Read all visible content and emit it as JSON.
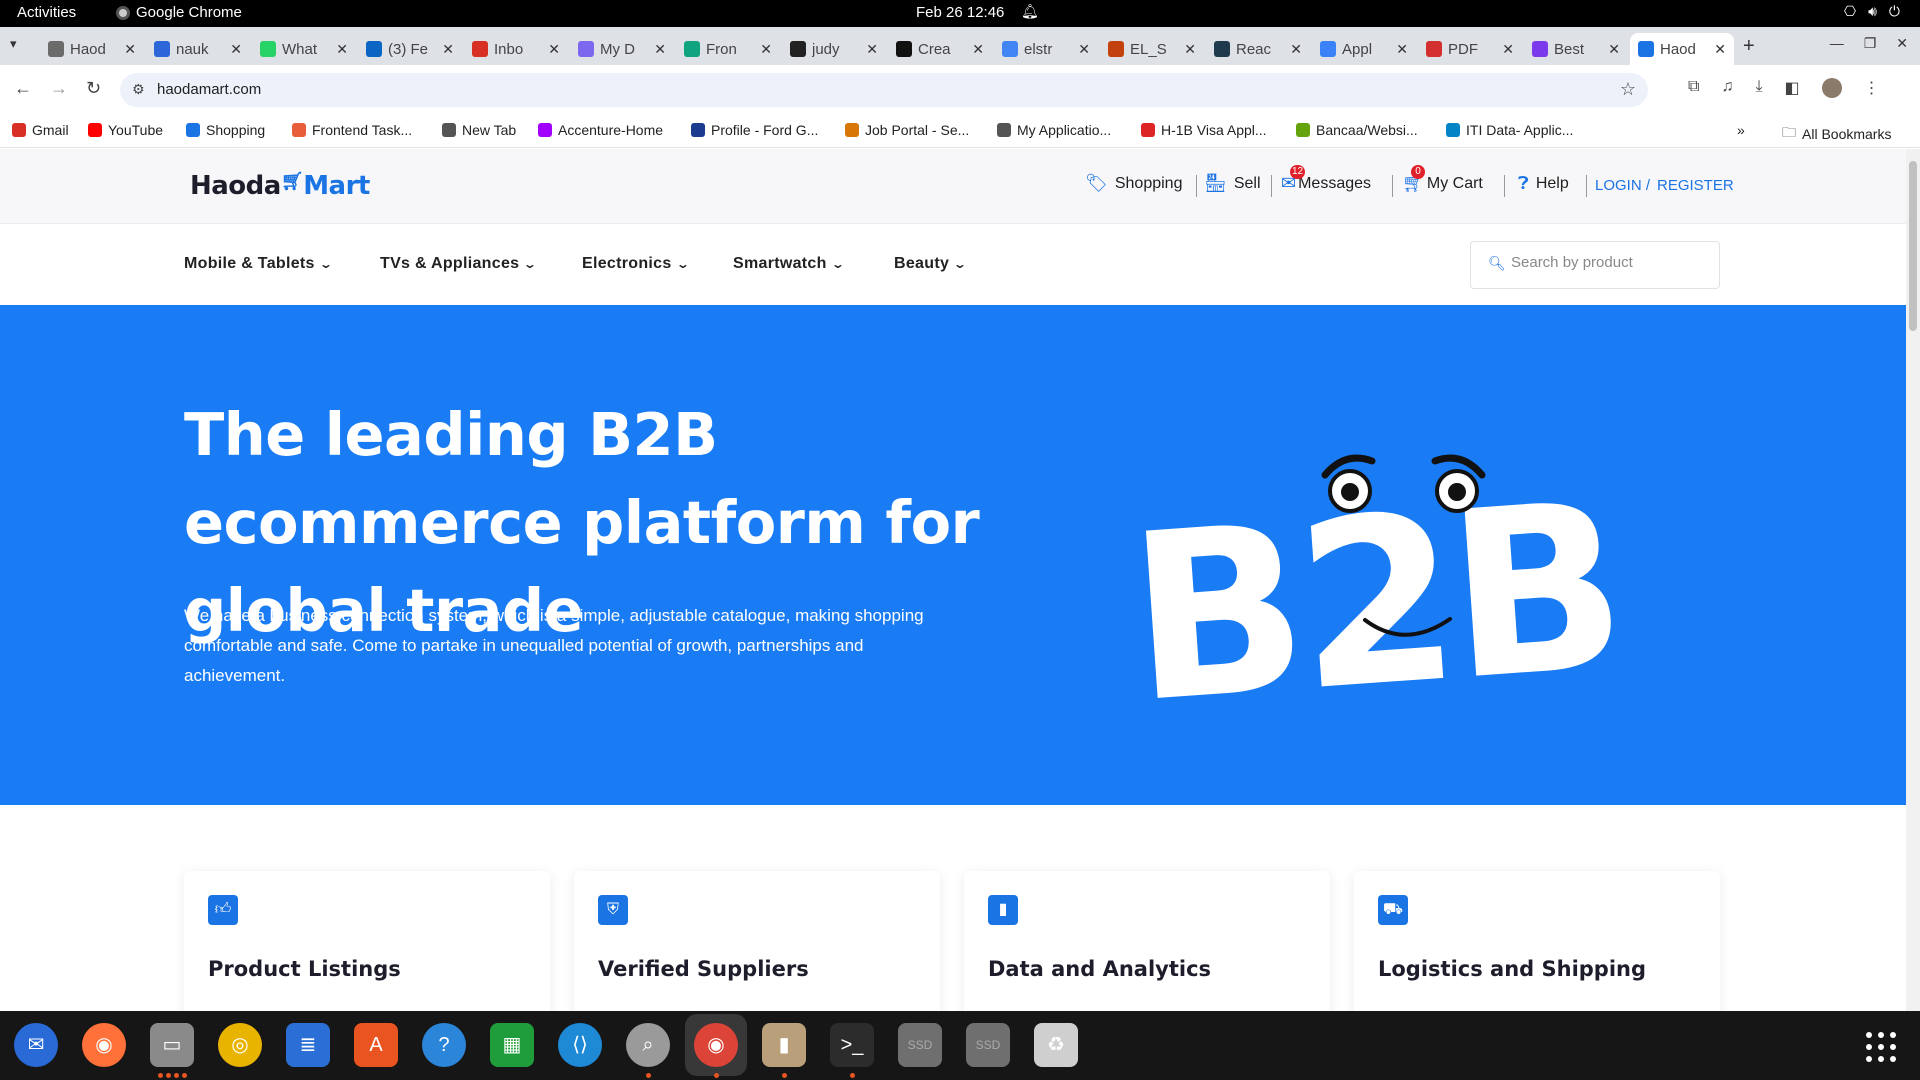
{
  "topbar": {
    "activities": "Activities",
    "app": "Google Chrome",
    "clock": "Feb 26  12:46"
  },
  "tabs": [
    {
      "label": "Haod",
      "color": "#6b6b6b"
    },
    {
      "label": "nauk",
      "color": "#2d66d9"
    },
    {
      "label": "What",
      "color": "#25d366"
    },
    {
      "label": "(3) Fe",
      "color": "#0a66c2"
    },
    {
      "label": "Inbo",
      "color": "#d93025"
    },
    {
      "label": "My D",
      "color": "#7b68ee"
    },
    {
      "label": "Fron",
      "color": "#10a37f"
    },
    {
      "label": "judy",
      "color": "#222222"
    },
    {
      "label": "Crea",
      "color": "#111111"
    },
    {
      "label": "elstr",
      "color": "#4285f4"
    },
    {
      "label": "EL_S",
      "color": "#c2410c"
    },
    {
      "label": "Reac",
      "color": "#1e3a4c"
    },
    {
      "label": "Appl",
      "color": "#3b82f6"
    },
    {
      "label": "PDF",
      "color": "#d32f2f"
    },
    {
      "label": "Best",
      "color": "#7c3aed"
    },
    {
      "label": "Haod",
      "color": "#1b74e4",
      "active": true
    }
  ],
  "address": {
    "url": "haodamart.com"
  },
  "bookmarks": [
    {
      "label": "Gmail",
      "color": "#d93025"
    },
    {
      "label": "YouTube",
      "color": "#ff0000"
    },
    {
      "label": "Shopping",
      "color": "#1b74e4"
    },
    {
      "label": "Frontend Task...",
      "color": "#e85d3a"
    },
    {
      "label": "New Tab",
      "color": "#555555"
    },
    {
      "label": "Accenture-Home",
      "color": "#a100ff"
    },
    {
      "label": "Profile - Ford G...",
      "color": "#1b3b8f"
    },
    {
      "label": "Job Portal - Se...",
      "color": "#d97706"
    },
    {
      "label": "My Applicatio...",
      "color": "#555555"
    },
    {
      "label": "H-1B Visa Appl...",
      "color": "#dc2626"
    },
    {
      "label": "Bancaa/Websi...",
      "color": "#65a30d"
    },
    {
      "label": "ITI Data- Applic...",
      "color": "#0284c7"
    }
  ],
  "bookmarks_more": "»",
  "all_bookmarks": "All Bookmarks",
  "site": {
    "logo_left": "Haoda",
    "logo_right": "Mart",
    "nav": {
      "shopping": "Shopping",
      "sell": "Sell",
      "messages": "Messages",
      "messages_count": "12",
      "cart": "My Cart",
      "cart_count": "0",
      "help": "Help",
      "login": "LOGIN /",
      "register": "REGISTER"
    },
    "categories": [
      "Mobile & Tablets",
      "TVs & Appliances",
      "Electronics",
      "Smartwatch",
      "Beauty"
    ],
    "search_placeholder": "Search by product",
    "hero": {
      "title": "The leading B2B ecommerce platform for global trade",
      "body": "We have a business connection system, which is a simple, adjustable catalogue, making shopping comfortable and safe. Come to partake in unequalled potential of growth, partnerships and achievement.",
      "graphic_text": "B2B"
    },
    "features": [
      {
        "title": "Product Listings",
        "icon": "thumbs-up-icon"
      },
      {
        "title": "Verified Suppliers",
        "icon": "shield-check-icon"
      },
      {
        "title": "Data and Analytics",
        "icon": "bar-chart-icon"
      },
      {
        "title": "Logistics and Shipping",
        "icon": "truck-icon"
      }
    ]
  },
  "colors": {
    "brand": "#1b74e4",
    "hero_bg": "#1a7cf5",
    "badge": "#e0202a"
  },
  "dock": [
    {
      "name": "thunderbird-app",
      "color": "#2a6ad6",
      "glyph": "✉"
    },
    {
      "name": "firefox-app",
      "color": "#ff7139",
      "glyph": "◉"
    },
    {
      "name": "files-app",
      "color": "#8a8a8a",
      "glyph": "▭"
    },
    {
      "name": "rhythmbox-app",
      "color": "#e8b400",
      "glyph": "◎"
    },
    {
      "name": "writer-app",
      "color": "#2b6fd6",
      "glyph": "≣"
    },
    {
      "name": "app-center-app",
      "color": "#e95420",
      "glyph": "A"
    },
    {
      "name": "help-app",
      "color": "#2b86d9",
      "glyph": "?"
    },
    {
      "name": "calc-app",
      "color": "#1f9d3a",
      "glyph": "▦"
    },
    {
      "name": "vscode-app",
      "color": "#1e8ad6",
      "glyph": "⟨⟩"
    },
    {
      "name": "image-viewer-app",
      "color": "#9a9a9a",
      "glyph": "⌕"
    },
    {
      "name": "chrome-app",
      "color": "#db4437",
      "glyph": "◉",
      "active": true
    },
    {
      "name": "archive-app",
      "color": "#b9a07a",
      "glyph": "▮"
    },
    {
      "name": "terminal-app",
      "color": "#2c2c2c",
      "glyph": ">_"
    },
    {
      "name": "ssd-drive-1",
      "color": "#6f6f6f",
      "glyph": "SSD"
    },
    {
      "name": "ssd-drive-2",
      "color": "#6f6f6f",
      "glyph": "SSD"
    },
    {
      "name": "trash-app",
      "color": "#cfcfcf",
      "glyph": "♻"
    }
  ]
}
